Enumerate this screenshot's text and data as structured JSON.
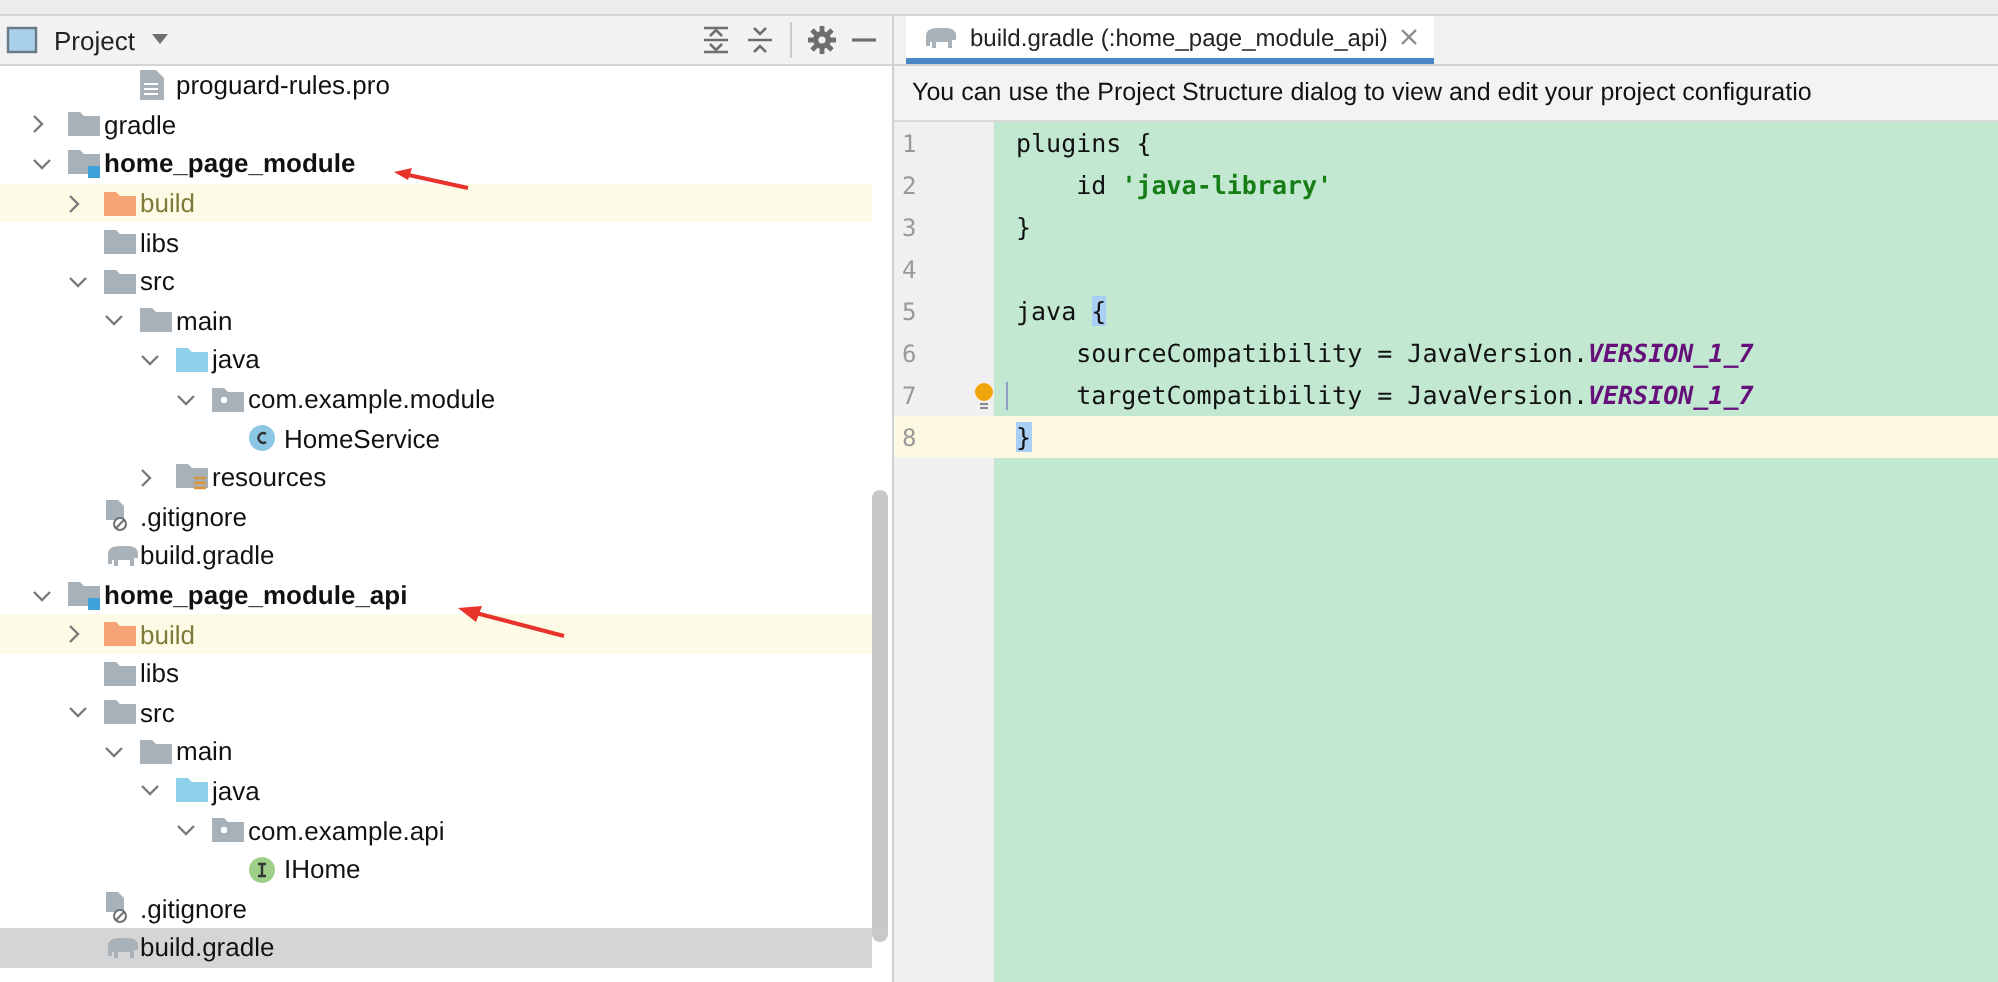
{
  "project_panel": {
    "title": "Project",
    "continued_items": [
      {
        "label": "proguard-rules.pro",
        "kind": "file",
        "selected": false
      }
    ],
    "tree": [
      {
        "label": "gradle",
        "kind": "folder",
        "expanded": false,
        "selected": false
      },
      {
        "label": "home_page_module",
        "kind": "module",
        "expanded": true,
        "selected": false,
        "children": [
          {
            "label": "build",
            "kind": "excluded",
            "expanded": false,
            "selected": false
          },
          {
            "label": "libs",
            "kind": "folder",
            "selected": false
          },
          {
            "label": "src",
            "kind": "folder",
            "expanded": true,
            "selected": false,
            "children": [
              {
                "label": "main",
                "kind": "folder",
                "expanded": true,
                "selected": false,
                "children": [
                  {
                    "label": "java",
                    "kind": "source",
                    "expanded": true,
                    "selected": false,
                    "children": [
                      {
                        "label": "com.example.module",
                        "kind": "package",
                        "expanded": true,
                        "selected": false,
                        "children": [
                          {
                            "label": "HomeService",
                            "kind": "class",
                            "selected": false
                          }
                        ]
                      }
                    ]
                  },
                  {
                    "label": "resources",
                    "kind": "resources",
                    "expanded": false,
                    "selected": false
                  }
                ]
              }
            ]
          },
          {
            "label": ".gitignore",
            "kind": "ignore",
            "selected": false
          },
          {
            "label": "build.gradle",
            "kind": "gradle",
            "selected": false
          }
        ]
      },
      {
        "label": "home_page_module_api",
        "kind": "module",
        "expanded": true,
        "selected": false,
        "children": [
          {
            "label": "build",
            "kind": "excluded",
            "expanded": false,
            "selected": false
          },
          {
            "label": "libs",
            "kind": "folder",
            "selected": false
          },
          {
            "label": "src",
            "kind": "folder",
            "expanded": true,
            "selected": false,
            "children": [
              {
                "label": "main",
                "kind": "folder",
                "expanded": true,
                "selected": false,
                "children": [
                  {
                    "label": "java",
                    "kind": "source",
                    "expanded": true,
                    "selected": false,
                    "children": [
                      {
                        "label": "com.example.api",
                        "kind": "package",
                        "expanded": true,
                        "selected": false,
                        "children": [
                          {
                            "label": "IHome",
                            "kind": "interface",
                            "selected": false
                          }
                        ]
                      }
                    ]
                  }
                ]
              }
            ]
          },
          {
            "label": ".gitignore",
            "kind": "ignore",
            "selected": false
          },
          {
            "label": "build.gradle",
            "kind": "gradle",
            "selected": true
          }
        ]
      }
    ]
  },
  "editor": {
    "tabs": [
      {
        "label": "build.gradle (:home_page_module_api)",
        "selected": true
      }
    ],
    "notice": "You can use the Project Structure dialog to view and edit your project configuratio",
    "lines": [
      {
        "number": "1",
        "current": false,
        "tokens": [
          {
            "kind": "plain",
            "text": "plugins "
          },
          {
            "kind": "plain",
            "text": "{"
          }
        ]
      },
      {
        "number": "2",
        "current": false,
        "tokens": [
          {
            "kind": "plain",
            "text": "    id "
          },
          {
            "kind": "string",
            "text": "'java-library'"
          }
        ]
      },
      {
        "number": "3",
        "current": false,
        "tokens": [
          {
            "kind": "plain",
            "text": "}"
          }
        ]
      },
      {
        "number": "4",
        "current": false
      },
      {
        "number": "5",
        "current": false,
        "tokens": [
          {
            "kind": "plain",
            "text": "java "
          },
          {
            "kind": "match",
            "text": "{"
          }
        ]
      },
      {
        "number": "6",
        "current": false,
        "tokens": [
          {
            "kind": "plain",
            "text": "    sourceCompatibility = JavaVersion."
          },
          {
            "kind": "constant",
            "text": "VERSION_1_7"
          }
        ]
      },
      {
        "number": "7",
        "current": false,
        "bulb": true,
        "tokens": [
          {
            "kind": "plain",
            "text": "    targetCompatibility = JavaVersion."
          },
          {
            "kind": "constant",
            "text": "VERSION_1_7"
          }
        ]
      },
      {
        "number": "8",
        "current": true,
        "tokens": [
          {
            "kind": "match",
            "text": "}"
          }
        ]
      }
    ]
  }
}
